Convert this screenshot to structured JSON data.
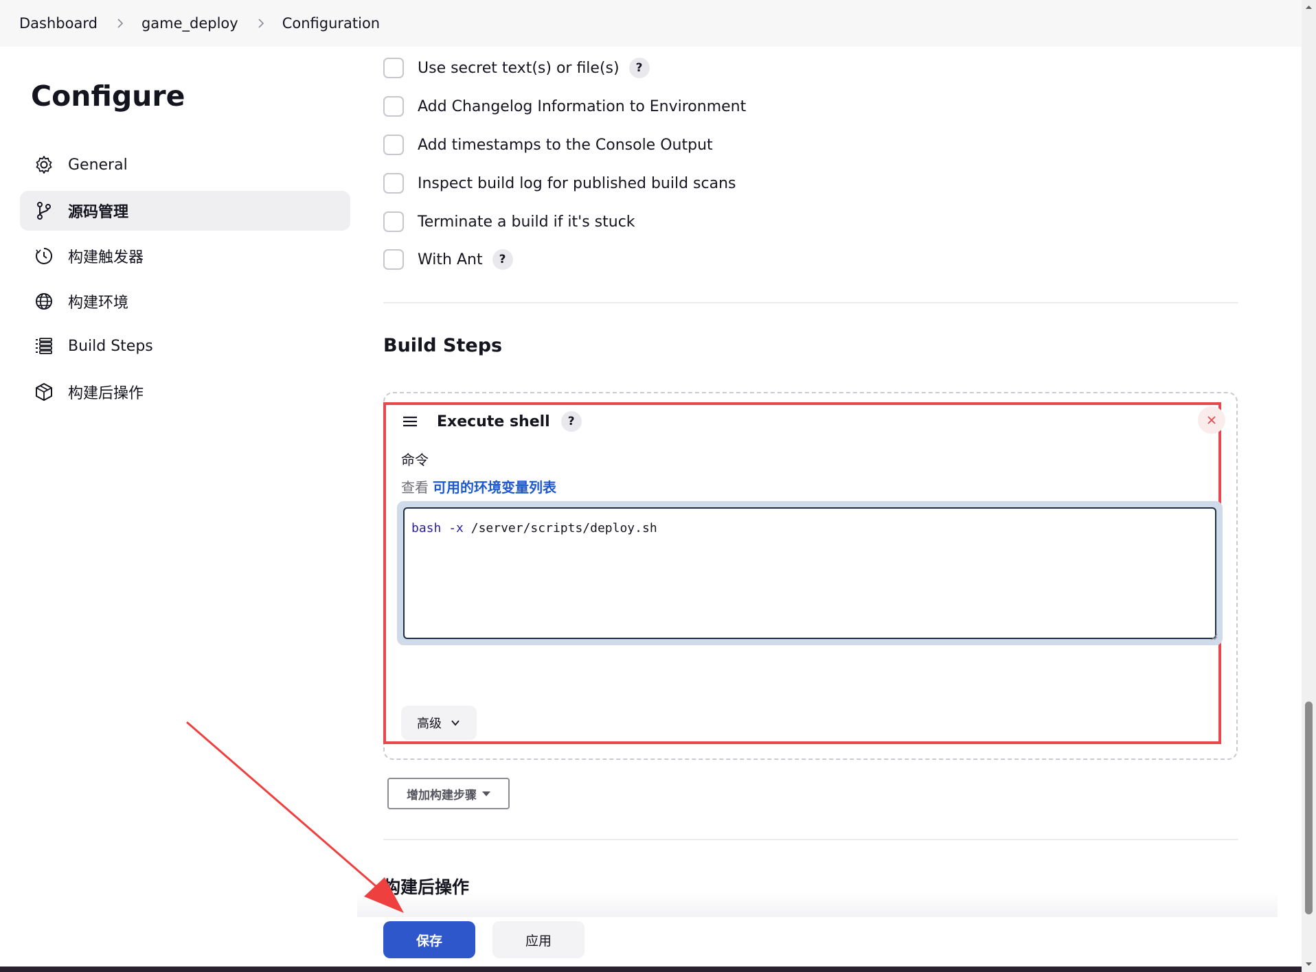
{
  "breadcrumb": {
    "items": [
      "Dashboard",
      "game_deploy",
      "Configuration"
    ]
  },
  "sidebar": {
    "title": "Configure",
    "items": [
      {
        "label": "General",
        "icon": "gear-icon"
      },
      {
        "label": "源码管理",
        "icon": "git-branch-icon",
        "active": true
      },
      {
        "label": "构建触发器",
        "icon": "timer-icon"
      },
      {
        "label": "构建环境",
        "icon": "globe-icon"
      },
      {
        "label": "Build Steps",
        "icon": "list-icon"
      },
      {
        "label": "构建后操作",
        "icon": "package-icon"
      }
    ]
  },
  "options": {
    "items": [
      {
        "label": "Use secret text(s) or file(s)",
        "help": "?"
      },
      {
        "label": "Add Changelog Information to Environment"
      },
      {
        "label": "Add timestamps to the Console Output"
      },
      {
        "label": "Inspect build log for published build scans"
      },
      {
        "label": "Terminate a build if it's stuck"
      },
      {
        "label": "With Ant",
        "help": "?"
      }
    ]
  },
  "build_steps": {
    "title": "Build Steps",
    "step": {
      "title": "Execute shell",
      "help": "?",
      "command_label": "命令",
      "env_prefix": "查看",
      "env_link": "可用的环境变量列表",
      "command_keyword": "bash",
      "command_flag": "-x",
      "command_rest": "/server/scripts/deploy.sh",
      "advanced_label": "高级"
    },
    "add_step_label": "增加构建步骤"
  },
  "post_build": {
    "title": "构建后操作"
  },
  "actions": {
    "save_label": "保存",
    "apply_label": "应用"
  },
  "colors": {
    "primary": "#2f57cc",
    "highlight_border": "#e5484d",
    "link": "#1b59d1",
    "annotation_arrow": "#ef4040"
  }
}
